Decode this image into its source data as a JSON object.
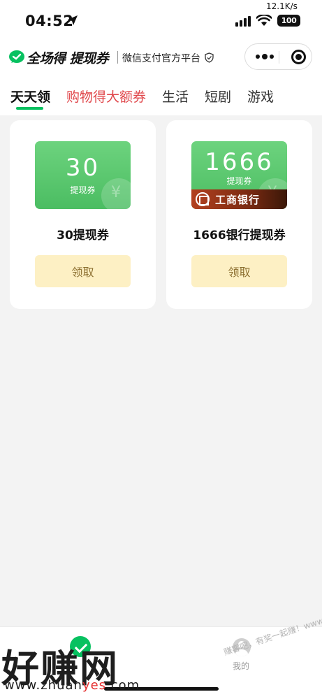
{
  "status_bar": {
    "time": "04:52",
    "net_speed": "12.1K/s",
    "battery": "100"
  },
  "header": {
    "brand_title_part1": "全场得",
    "brand_title_part2": "提现券",
    "brand_subtitle": "微信支付官方平台",
    "accent_color": "#07c160"
  },
  "tabs": [
    {
      "label": "天天领",
      "active": true
    },
    {
      "label": "购物得大额券",
      "active": false
    },
    {
      "label": "生活",
      "active": false
    },
    {
      "label": "短剧",
      "active": false
    },
    {
      "label": "游戏",
      "active": false
    }
  ],
  "cards": [
    {
      "coupon_amount": "30",
      "coupon_label": "提现券",
      "title": "30提现券",
      "button": "领取"
    },
    {
      "coupon_amount": "1666",
      "coupon_label": "提现券",
      "bank": "工商银行",
      "title": "1666银行提现券",
      "button": "领取"
    }
  ],
  "bottom_nav": {
    "mine_label": "我的"
  },
  "watermark": {
    "big_text": "好赚网",
    "url_part1": "www.zhuan",
    "url_part2": "yes",
    "url_part3": ".com",
    "faint_text": "赚客吧，有奖一起赚！www.zuanke8.com"
  }
}
